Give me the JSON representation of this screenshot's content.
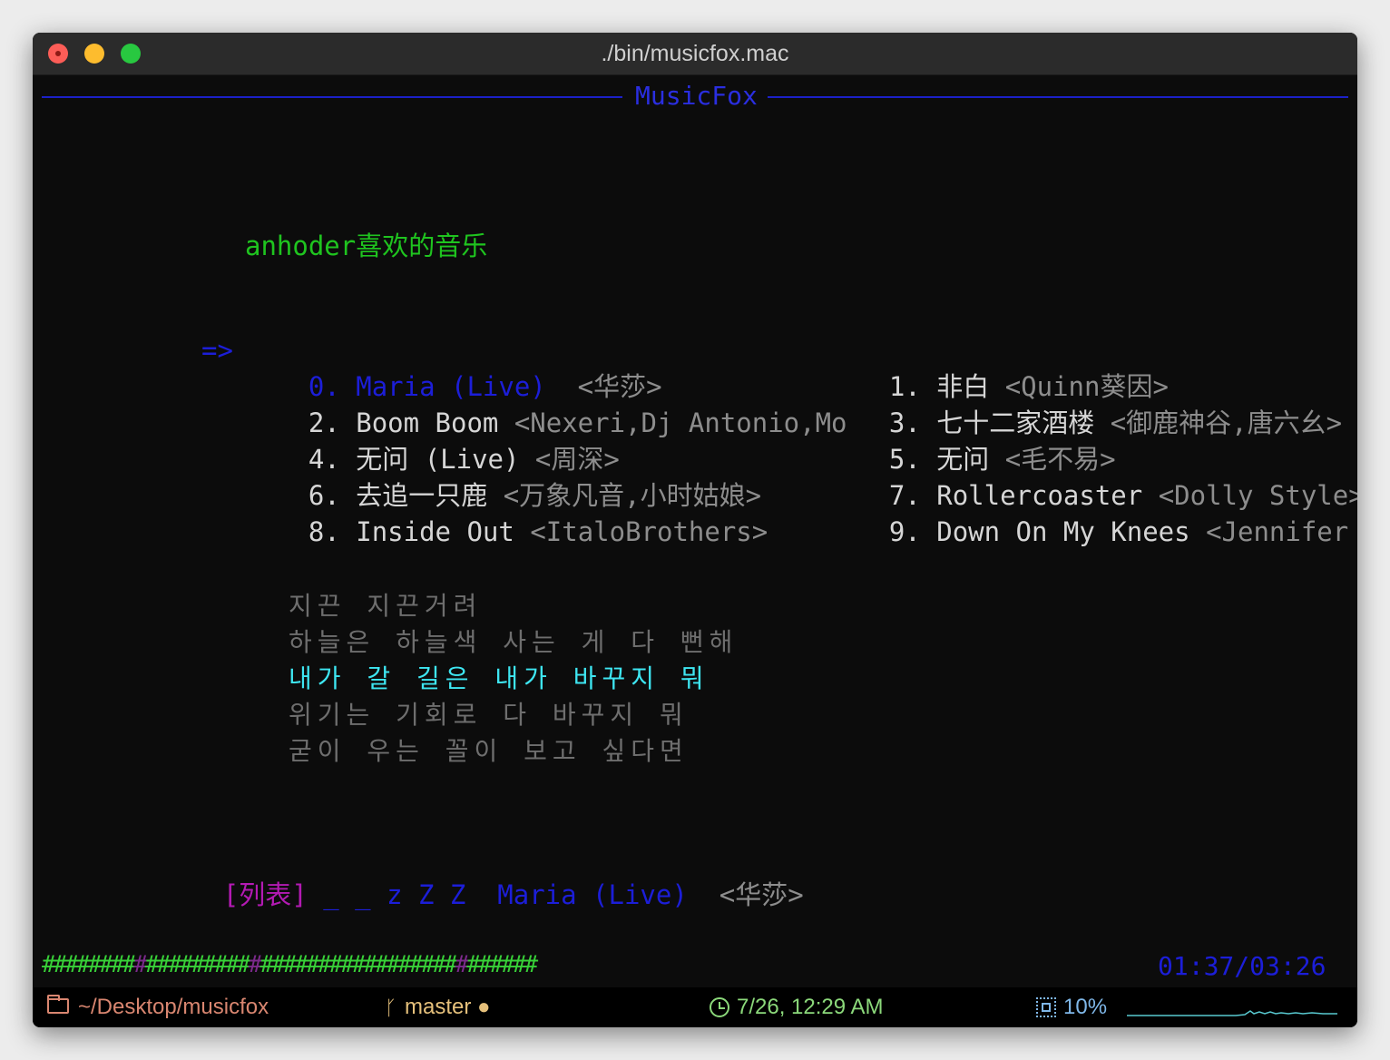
{
  "window": {
    "title": "./bin/musicfox.mac"
  },
  "header": {
    "title": "MusicFox"
  },
  "playlist": {
    "title": "anhoder喜欢的音乐"
  },
  "cursor": "=>",
  "songs": [
    {
      "num": "0.",
      "name": "Maria (Live)",
      "artist": "<华莎>"
    },
    {
      "num": "1.",
      "name": "非白",
      "artist": "<Quinn葵因>"
    },
    {
      "num": "2.",
      "name": "Boom Boom",
      "artist": "<Nexeri,Dj Antonio,Mo"
    },
    {
      "num": "3.",
      "name": "七十二家酒楼",
      "artist": "<御鹿神谷,唐六幺>"
    },
    {
      "num": "4.",
      "name": "无问 (Live)",
      "artist": "<周深>"
    },
    {
      "num": "5.",
      "name": "无问",
      "artist": "<毛不易>"
    },
    {
      "num": "6.",
      "name": "去追一只鹿",
      "artist": "<万象凡音,小时姑娘>"
    },
    {
      "num": "7.",
      "name": "Rollercoaster",
      "artist": "<Dolly Style>"
    },
    {
      "num": "8.",
      "name": "Inside Out",
      "artist": "<ItaloBrothers>"
    },
    {
      "num": "9.",
      "name": "Down On My Knees",
      "artist": "<Jennifer Rush"
    }
  ],
  "lyrics": [
    "지끈 지끈거려",
    "하늘은 하늘색 사는 게 다 뻔해",
    "내가 갈 길은 내가 바꾸지 뭐",
    "위기는 기회로 다 바꾸지 뭐",
    "굳이 우는 꼴이 보고 싶다면"
  ],
  "now_playing": {
    "tag": "[列表]",
    "indicator": "_ _ z Z Z",
    "name": "Maria (Live)",
    "artist": "<华莎>"
  },
  "playback": {
    "time": "01:37/03:26",
    "progress": 0.47
  },
  "statusbar": {
    "path": "~/Desktop/musicfox",
    "branch": "master ●",
    "datetime": "7/26, 12:29 AM",
    "cpu": "10%"
  }
}
